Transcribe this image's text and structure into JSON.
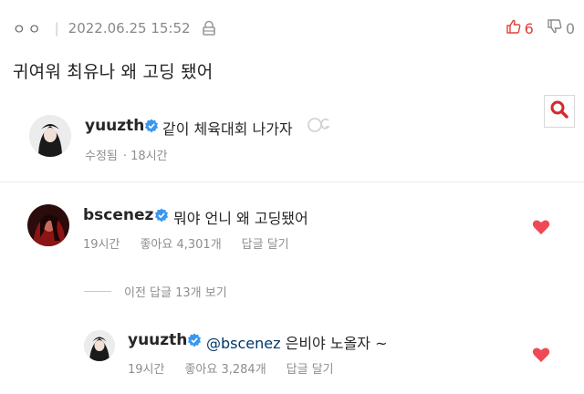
{
  "post": {
    "author": "ㅇㅇ",
    "separator": "|",
    "datetime": "2022.06.25 15:52",
    "title": "귀여워 최유나 왜 고딩 됐어",
    "upvotes": "6",
    "downvotes": "0"
  },
  "caption": {
    "username": "yuuzth",
    "text": "같이 체육대회 나가자",
    "edited": "수정됨",
    "time": "· 18시간"
  },
  "comments": [
    {
      "username": "bscenez",
      "text": "뭐야 언니 왜 고딩됐어",
      "time": "19시간",
      "likes": "좋아요 4,301개",
      "reply": "답글 달기"
    }
  ],
  "more_replies": "이전 답글 13개 보기",
  "reply": {
    "username": "yuuzth",
    "mention": "@bscenez",
    "text": " 은비야 노올자 ~",
    "time": "19시간",
    "likes": "좋아요 3,284개",
    "reply": "답글 달기"
  },
  "colors": {
    "heart": "#ed4956",
    "verified": "#3897f0",
    "upvote": "#e0403a",
    "search": "#d42a2a"
  }
}
